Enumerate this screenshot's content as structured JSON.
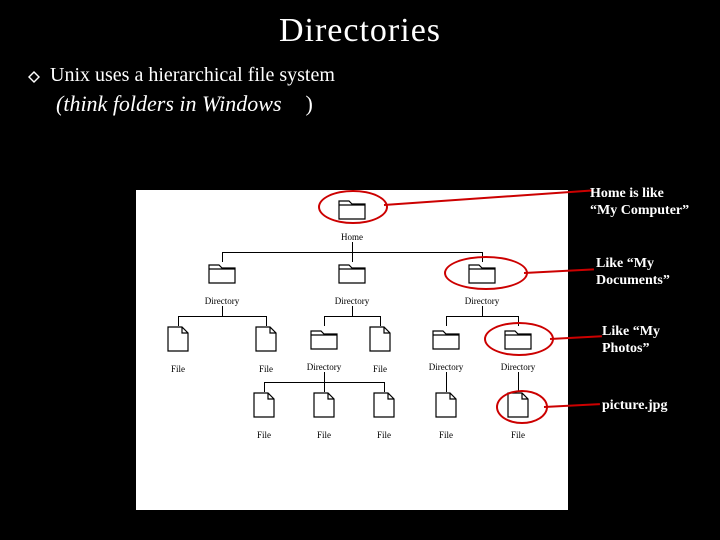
{
  "title": "Directories",
  "bullet": "Unix uses a hierarchical file system",
  "subnote_open": "(",
  "subnote_text": "think folders in Windows",
  "subnote_close": ")",
  "labels": {
    "home": "Home",
    "dir": "Directory",
    "file": "File"
  },
  "annotations": {
    "a1_l1": "Home is like",
    "a1_l2": "“My Computer”",
    "a2_l1": "Like “My",
    "a2_l2": "Documents”",
    "a3_l1": "Like “My",
    "a3_l2": "Photos”",
    "a4": "picture.jpg"
  }
}
